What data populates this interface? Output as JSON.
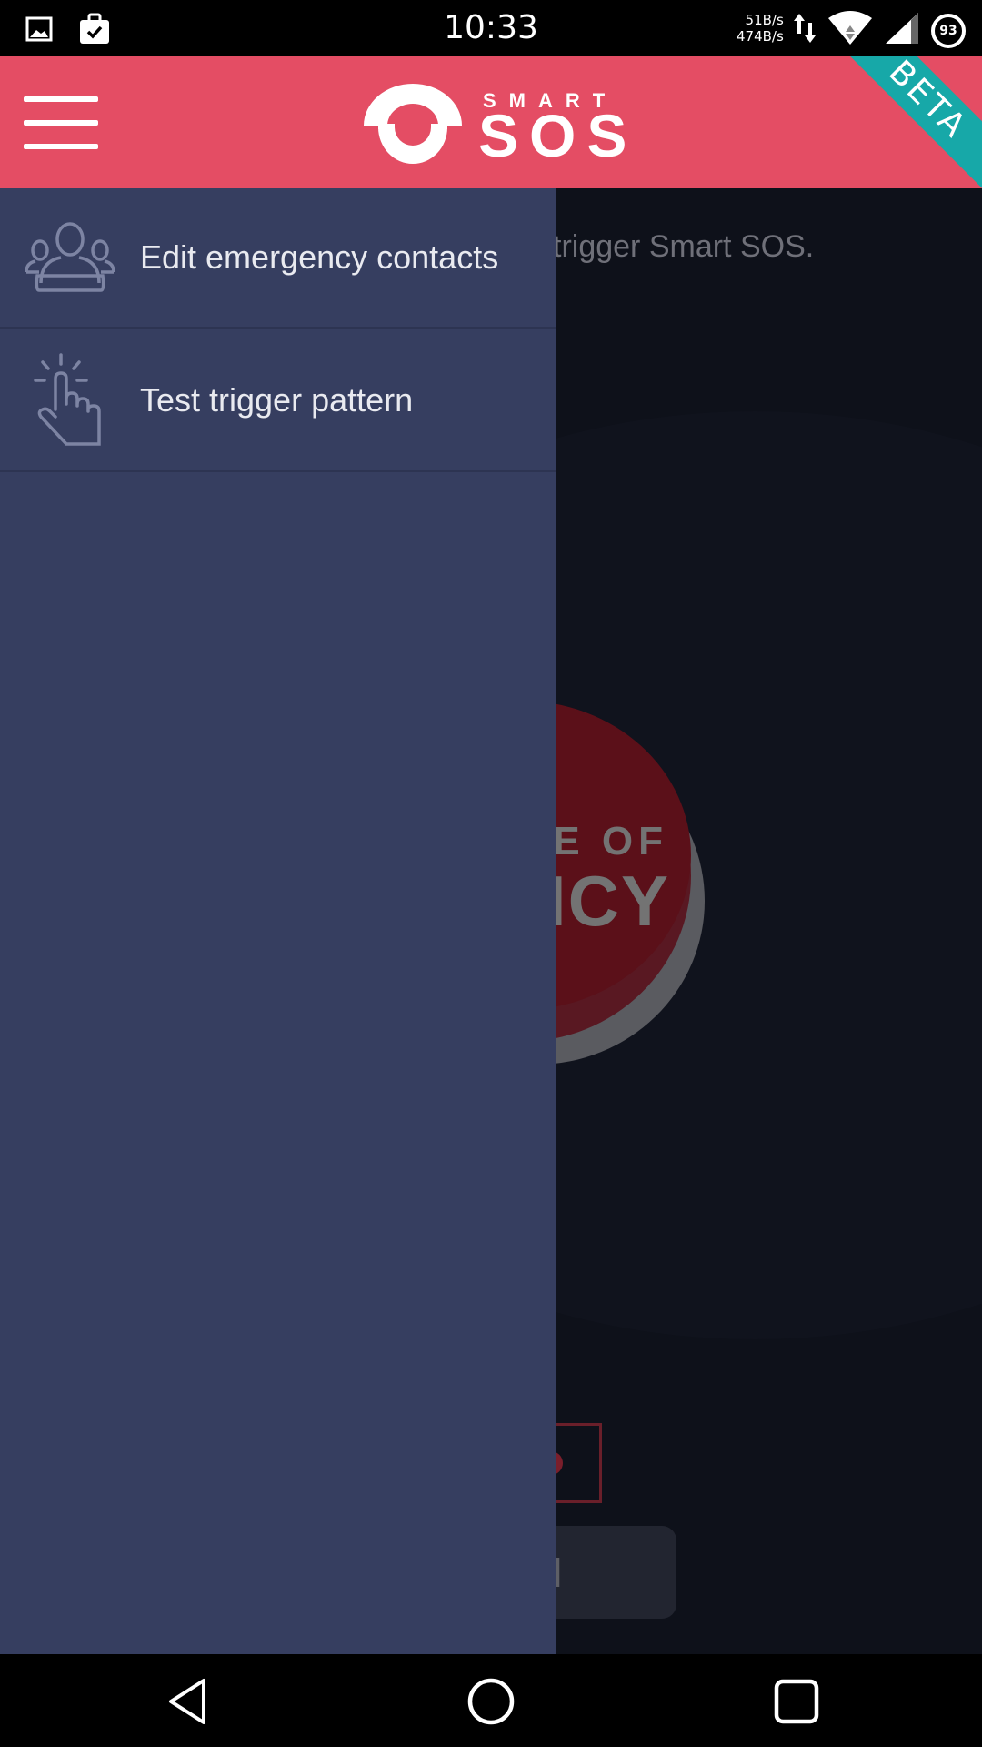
{
  "status_bar": {
    "time": "10:33",
    "upload_speed": "51B/s",
    "download_speed": "474B/s",
    "battery_level": "93",
    "icons": [
      "image-icon",
      "briefcase-check-icon",
      "data-transfer-icon",
      "wifi-icon",
      "cell-signal-icon",
      "battery-icon"
    ]
  },
  "app": {
    "header": {
      "logo_top": "SMART",
      "logo_bottom": "SOS",
      "beta_label": "BETA",
      "accent_color": "#e44d64",
      "ribbon_color": "#17a8a8"
    },
    "instruction_text": "trigger Smart SOS.",
    "sos_button": {
      "line1": "SE OF",
      "line2": "NCY"
    },
    "alarm_button_label": "M"
  },
  "drawer": {
    "background_color": "#363e60",
    "items": [
      {
        "label": "Edit emergency contacts",
        "icon": "contacts-group-icon"
      },
      {
        "label": "Test trigger pattern",
        "icon": "tap-finger-icon"
      }
    ]
  },
  "nav_bar": {
    "buttons": [
      "back",
      "home",
      "recents"
    ]
  }
}
